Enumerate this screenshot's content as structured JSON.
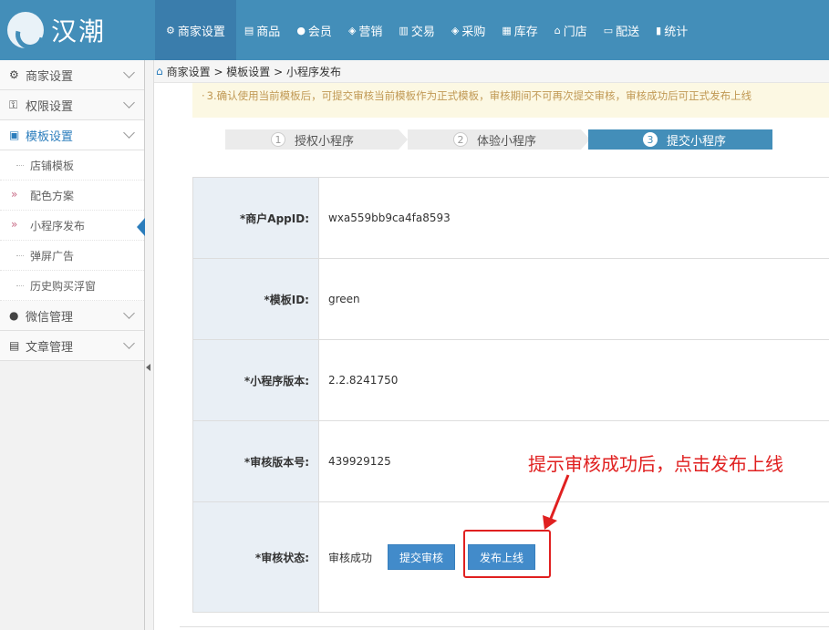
{
  "app": {
    "logo_text": "汉潮"
  },
  "nav": [
    {
      "icon": "gear-icon",
      "glyph": "⚙",
      "label": "商家设置"
    },
    {
      "icon": "goods-icon",
      "glyph": "▤",
      "label": "商品"
    },
    {
      "icon": "user-icon",
      "glyph": "●",
      "label": "会员"
    },
    {
      "icon": "tag-icon",
      "glyph": "◈",
      "label": "营销"
    },
    {
      "icon": "document-icon",
      "glyph": "▥",
      "label": "交易"
    },
    {
      "icon": "cart-icon",
      "glyph": "◈",
      "label": "采购"
    },
    {
      "icon": "storage-icon",
      "glyph": "▦",
      "label": "库存"
    },
    {
      "icon": "home-icon",
      "glyph": "⌂",
      "label": "门店"
    },
    {
      "icon": "truck-icon",
      "glyph": "▭",
      "label": "配送"
    },
    {
      "icon": "bar-chart-icon",
      "glyph": "▮",
      "label": "统计"
    }
  ],
  "sidebar": {
    "items": [
      {
        "label": "商家设置",
        "glyph": "⚙"
      },
      {
        "label": "权限设置",
        "glyph": "⚿"
      },
      {
        "label": "模板设置",
        "glyph": "▣"
      },
      {
        "label": "微信管理",
        "glyph": "●"
      },
      {
        "label": "文章管理",
        "glyph": "▤"
      }
    ],
    "sub_items": [
      {
        "label": "店铺模板"
      },
      {
        "label": "配色方案"
      },
      {
        "label": "小程序发布"
      },
      {
        "label": "弹屏广告"
      },
      {
        "label": "历史购买浮窗"
      }
    ]
  },
  "breadcrumb": {
    "text": "商家设置 > 模板设置 > 小程序发布"
  },
  "notice": {
    "text": "3.确认使用当前模板后，可提交审核当前模板作为正式模板，审核期间不可再次提交审核，审核成功后可正式发布上线"
  },
  "steps": [
    {
      "num": "1",
      "label": "授权小程序"
    },
    {
      "num": "2",
      "label": "体验小程序"
    },
    {
      "num": "3",
      "label": "提交小程序"
    }
  ],
  "form": {
    "appid_label": "*商户AppID:",
    "appid_value": "wxa559bb9ca4fa8593",
    "template_label": "*模板ID:",
    "template_value": "green",
    "version_label": "*小程序版本:",
    "version_value": "2.2.8241750",
    "audit_version_label": "*审核版本号:",
    "audit_version_value": "439929125",
    "status_label": "*审核状态:",
    "status_value": "审核成功",
    "submit_button": "提交审核",
    "publish_button": "发布上线"
  },
  "annotation": {
    "text": "提示审核成功后，点击发布上线",
    "color": "#e02020"
  },
  "colors": {
    "brand": "#438eb9",
    "button": "#428bca",
    "label_bg": "#e9eff5",
    "notice_text": "#c09853"
  }
}
